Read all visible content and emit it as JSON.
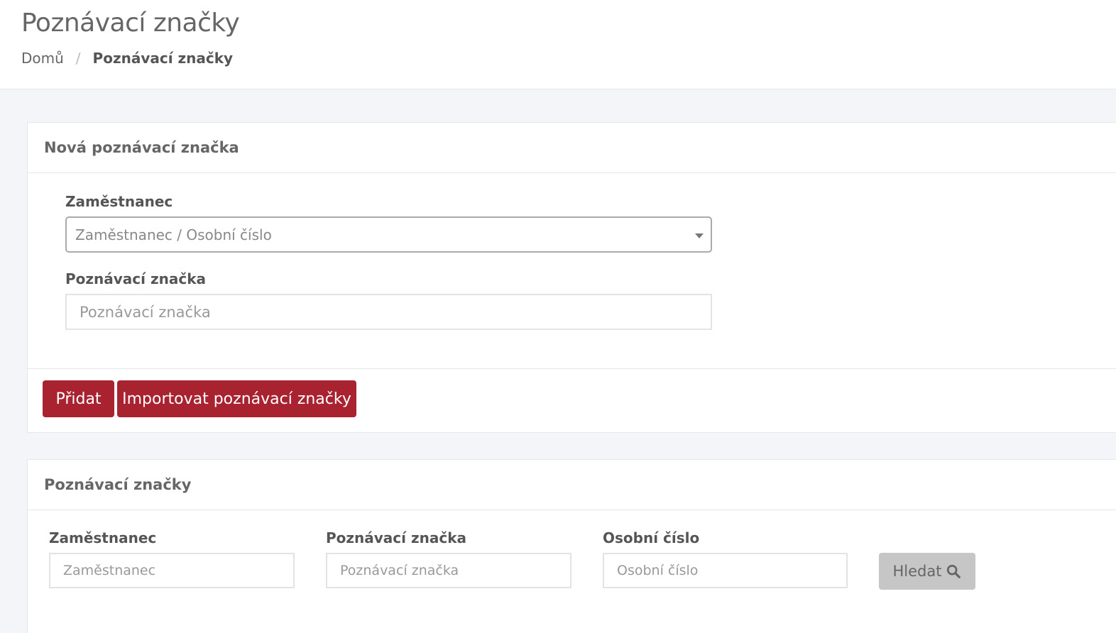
{
  "header": {
    "title": "Poznávací značky",
    "breadcrumb": {
      "home": "Domů",
      "separator": "/",
      "current": "Poznávací značky"
    }
  },
  "new_plate_panel": {
    "heading": "Nová poznávací značka",
    "employee_label": "Zaměstnanec",
    "employee_select_placeholder": "Zaměstnanec / Osobní číslo",
    "plate_label": "Poznávací značka",
    "plate_placeholder": "Poznávací značka",
    "add_button": "Přidat",
    "import_button": "Importovat poznávací značky"
  },
  "list_panel": {
    "heading": "Poznávací značky",
    "filters": {
      "employee_label": "Zaměstnanec",
      "employee_placeholder": "Zaměstnanec",
      "plate_label": "Poznávací značka",
      "plate_placeholder": "Poznávací značka",
      "personal_number_label": "Osobní číslo",
      "personal_number_placeholder": "Osobní číslo",
      "search_button": "Hledat",
      "search_icon": "search-icon"
    }
  },
  "colors": {
    "primary_button": "#a8222f",
    "search_button": "#c6c6c6",
    "background": "#f4f5f8"
  }
}
